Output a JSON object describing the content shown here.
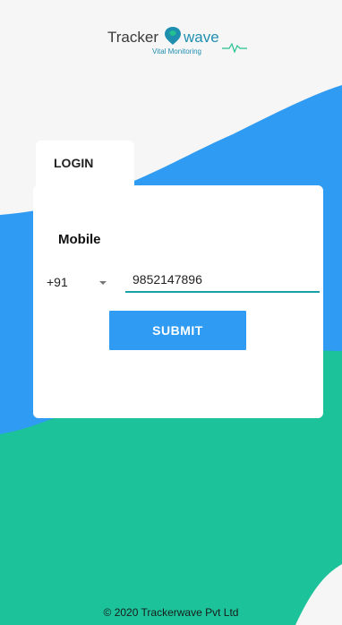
{
  "colors": {
    "background": "#f6f6f6",
    "blue_wave": "#2f9bf3",
    "teal_wave": "#1cc39a",
    "accent": "#1aa0a7",
    "button": "#2f9bf3"
  },
  "logo": {
    "brand_left": "Tracker",
    "brand_right": "wave",
    "tagline": "Vital Monitoring",
    "icon": "location-pin-icon"
  },
  "login": {
    "tab_label": "LOGIN",
    "mobile_label": "Mobile",
    "country_code": "+91",
    "phone_value": "9852147896",
    "submit_label": "SUBMIT"
  },
  "footer": {
    "copyright": "© 2020 Trackerwave Pvt Ltd"
  }
}
